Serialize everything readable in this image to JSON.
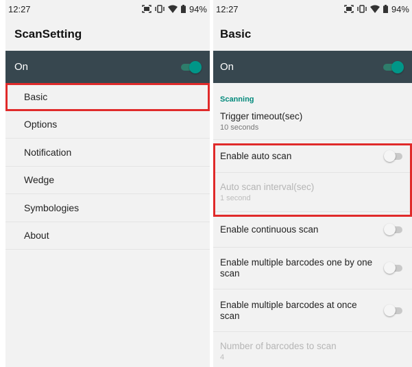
{
  "left": {
    "status": {
      "time": "12:27",
      "battery": "94%"
    },
    "title": "ScanSetting",
    "on_label": "On",
    "menu": [
      {
        "label": "Basic"
      },
      {
        "label": "Options"
      },
      {
        "label": "Notification"
      },
      {
        "label": "Wedge"
      },
      {
        "label": "Symbologies"
      },
      {
        "label": "About"
      }
    ]
  },
  "right": {
    "status": {
      "time": "12:27",
      "battery": "94%"
    },
    "title": "Basic",
    "on_label": "On",
    "section": "Scanning",
    "prefs": [
      {
        "title": "Trigger timeout(sec)",
        "summary": "10 seconds"
      },
      {
        "title": "Enable auto scan"
      },
      {
        "title": "Auto scan interval(sec)",
        "summary": "1 second"
      },
      {
        "title": "Enable continuous scan"
      },
      {
        "title": "Enable multiple barcodes one by one scan"
      },
      {
        "title": "Enable multiple barcodes at once scan"
      },
      {
        "title": "Number of barcodes to scan",
        "summary": "4"
      }
    ]
  },
  "colors": {
    "toolbar": "#37474f",
    "accent": "#009688",
    "highlight": "#e02a2a"
  },
  "icons": [
    "scanner-icon",
    "vibrate-icon",
    "wifi-icon",
    "battery-icon"
  ]
}
